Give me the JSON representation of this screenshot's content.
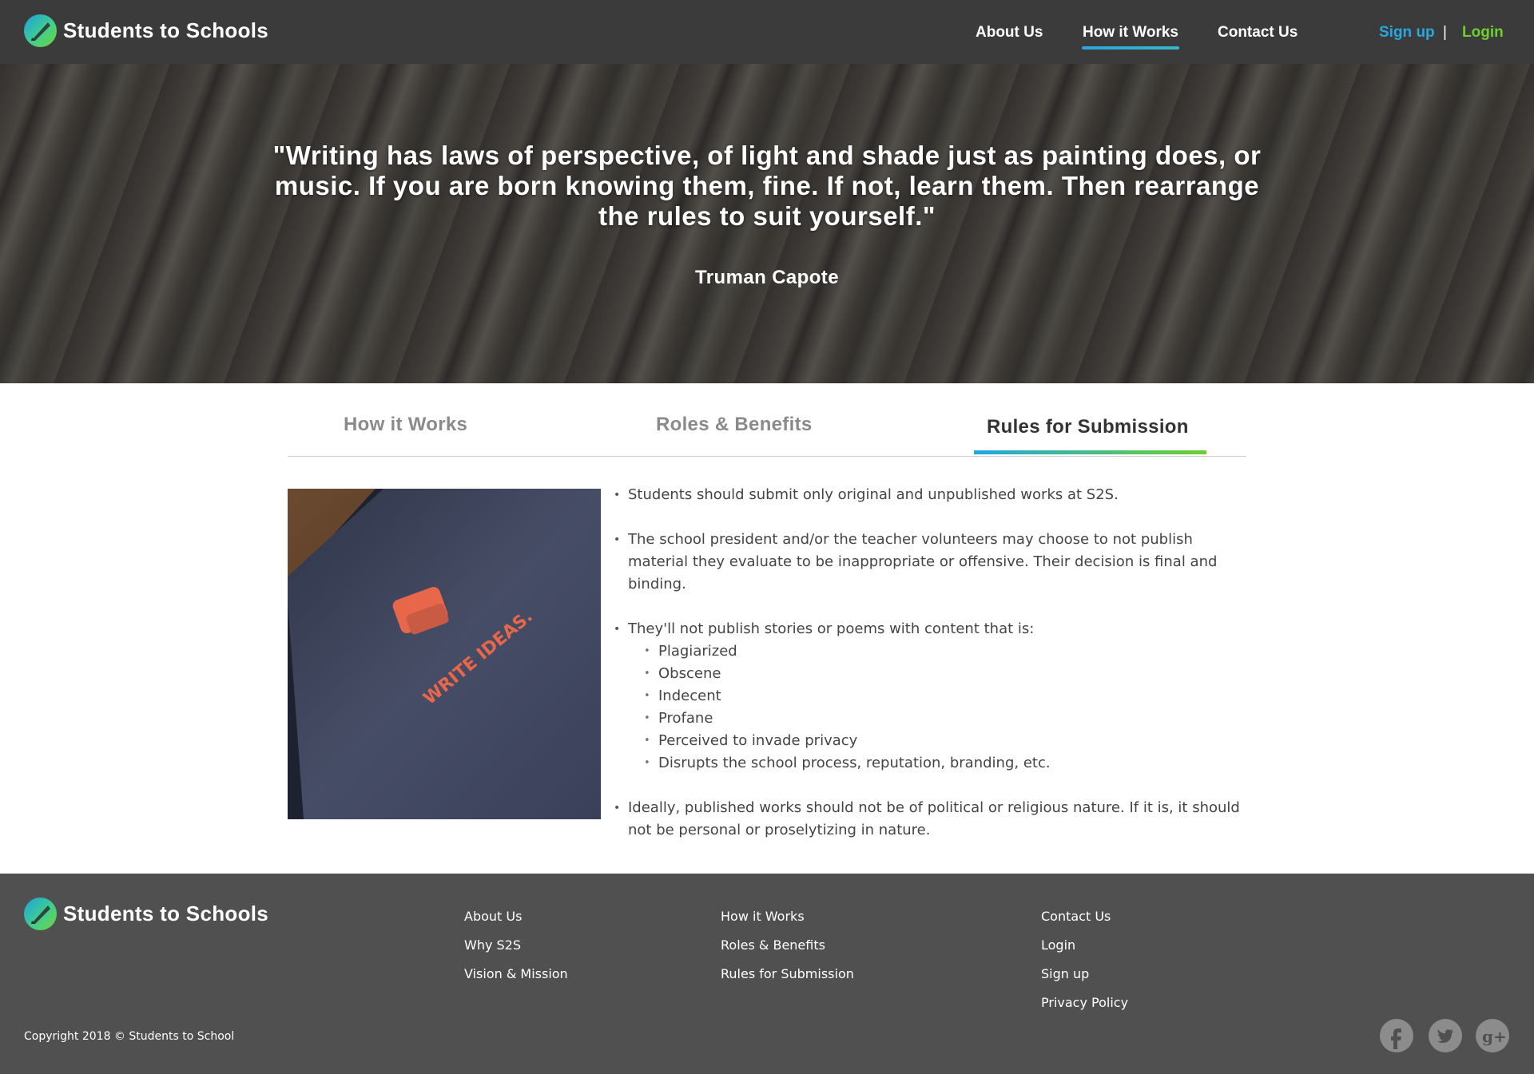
{
  "header": {
    "brand": "Students to Schools",
    "nav": [
      "About Us",
      "How it Works",
      "Contact Us"
    ],
    "active_nav": "How it Works",
    "signup": "Sign up",
    "separator": "|",
    "login": "Login"
  },
  "hero": {
    "quote": "\"Writing has laws of perspective, of light and shade just as painting does, or music. If you are born knowing them, fine. If not, learn them. Then rearrange the rules to suit yourself.\"",
    "author": "Truman Capote"
  },
  "tabs": {
    "items": [
      "How it Works",
      "Roles & Benefits",
      "Rules for Submission"
    ],
    "active": "Rules for Submission"
  },
  "image": {
    "text": "WRITE IDEAS."
  },
  "rules": {
    "items": [
      "Students should submit only original and unpublished works at S2S.",
      "The school president and/or the teacher volunteers may choose to not publish material they evaluate to be inappropriate or offensive. Their decision is final and binding.",
      "They'll not publish stories or poems with content that is:",
      "Ideally, published works should not be of political or religious nature. If it is, it should not be personal or proselytizing in nature."
    ],
    "subitems": [
      "Plagiarized",
      "Obscene",
      "Indecent",
      "Profane",
      "Perceived to invade privacy",
      "Disrupts the school process, reputation, branding, etc."
    ]
  },
  "footer": {
    "brand": "Students to Schools",
    "col1": [
      "About Us",
      "Why S2S",
      "Vision & Mission"
    ],
    "col2": [
      "How it Works",
      "Roles & Benefits",
      "Rules for Submission"
    ],
    "col3": [
      "Contact Us",
      "Login",
      "Sign up",
      "Privacy Policy"
    ],
    "copyright": "Copyright 2018 ©  Students to School",
    "social": [
      "facebook-icon",
      "twitter-icon",
      "google-plus-icon"
    ]
  },
  "colors": {
    "header_bg": "#3b3b3b",
    "footer_bg": "#505050",
    "accent_blue": "#2aa7de",
    "accent_green": "#6fcf2f",
    "tab_active_text": "#333333",
    "tab_inactive_text": "#8a8a8a",
    "image_logo": "#e8664a"
  }
}
